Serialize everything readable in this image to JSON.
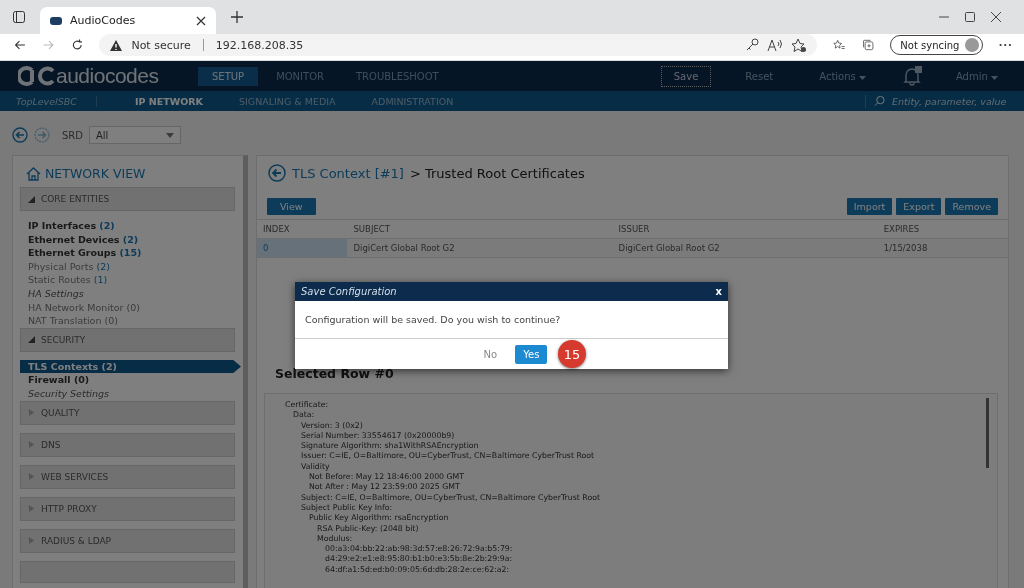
{
  "browser": {
    "tab_title": "AudioCodes",
    "security": "Not secure",
    "address": "192.168.208.35",
    "profile": "Not syncing"
  },
  "header": {
    "logo": "audiocodes",
    "tabs": [
      {
        "label": "SETUP",
        "selected": true
      },
      {
        "label": "MONITOR",
        "selected": false
      },
      {
        "label": "TROUBLESHOOT",
        "selected": false
      }
    ],
    "actions": [
      {
        "label": "Save",
        "kind": "outlined"
      },
      {
        "label": "Reset",
        "kind": "plain"
      },
      {
        "label": "Actions",
        "kind": "menu"
      }
    ],
    "user": "Admin"
  },
  "subnav": {
    "device": "TopLevelSBC",
    "tabs": [
      {
        "label": "IP NETWORK",
        "selected": true
      },
      {
        "label": "SIGNALING & MEDIA",
        "selected": false
      },
      {
        "label": "ADMINISTRATION",
        "selected": false
      }
    ],
    "search": {
      "placeholder": "Entity, parameter, value"
    }
  },
  "toolbar": {
    "srd_label": "SRD",
    "srd_value": "All"
  },
  "sidebar": {
    "title": "NETWORK VIEW",
    "sections": [
      {
        "label": "CORE ENTITIES",
        "expanded": true,
        "items": [
          {
            "label": "IP Interfaces",
            "count": "(2)",
            "kind": "entity",
            "selected": false
          },
          {
            "label": "Ethernet Devices",
            "count": "(2)",
            "kind": "entity",
            "selected": false
          },
          {
            "label": "Ethernet Groups",
            "count": "(15)",
            "kind": "entity",
            "selected": false
          },
          {
            "label": "Physical Ports",
            "count": "(2)",
            "kind": "plain",
            "selected": false
          },
          {
            "label": "Static Routes",
            "count": "(1)",
            "kind": "plain",
            "selected": false
          },
          {
            "label": "HA Settings",
            "kind": "page",
            "selected": false
          },
          {
            "label": "HA Network Monitor (0)",
            "kind": "plain",
            "selected": false
          },
          {
            "label": "NAT Translation (0)",
            "kind": "plain",
            "selected": false
          }
        ]
      },
      {
        "label": "SECURITY",
        "expanded": true,
        "items": [
          {
            "label": "TLS Contexts (2)",
            "kind": "entity",
            "selected": true
          },
          {
            "label": "Firewall (0)",
            "kind": "entity",
            "selected": false
          },
          {
            "label": "Security Settings",
            "kind": "page",
            "selected": false
          }
        ]
      },
      {
        "label": "QUALITY",
        "expanded": false
      },
      {
        "label": "DNS",
        "expanded": false
      },
      {
        "label": "WEB SERVICES",
        "expanded": false
      },
      {
        "label": "HTTP PROXY",
        "expanded": false
      },
      {
        "label": "RADIUS & LDAP",
        "expanded": false
      }
    ]
  },
  "main": {
    "breadcrumb_link": "TLS Context [#1]",
    "breadcrumb_rest": "> Trusted Root Certificates",
    "left_buttons": [
      "View"
    ],
    "right_buttons": [
      "Import",
      "Export",
      "Remove"
    ],
    "table": {
      "columns": [
        "INDEX",
        "SUBJECT",
        "ISSUER",
        "EXPIRES"
      ],
      "rows": [
        {
          "selected": true,
          "cells": [
            "0",
            "DigiCert Global Root G2",
            "DigiCert Global Root G2",
            "1/15/2038"
          ]
        }
      ]
    },
    "detail_title": "Selected Row #0",
    "certificate": [
      {
        "text": "Certificate:",
        "children": [
          {
            "text": "Data:",
            "children": [
              {
                "text": "Version: 3 (0x2)"
              },
              {
                "text": "Serial Number: 33554617 (0x20000b9)"
              },
              {
                "text": "Signature Algorithm: sha1WithRSAEncryption"
              },
              {
                "text": "Issuer: C=IE, O=Baltimore, OU=CyberTrust, CN=Baltimore CyberTrust Root"
              },
              {
                "text": "Validity",
                "children": [
                  {
                    "text": "Not Before: May 12 18:46:00 2000 GMT"
                  },
                  {
                    "text": "Not After : May 12 23:59:00 2025 GMT"
                  }
                ]
              },
              {
                "text": "Subject: C=IE, O=Baltimore, OU=CyberTrust, CN=Baltimore CyberTrust Root"
              },
              {
                "text": "Subject Public Key Info:",
                "children": [
                  {
                    "text": "Public Key Algorithm: rsaEncryption",
                    "children": [
                      {
                        "text": "RSA Public-Key: (2048 bit)"
                      },
                      {
                        "text": "Modulus:",
                        "children": [
                          {
                            "text": "00:a3:04:bb:22:ab:98:3d:57:e8:26:72:9a:b5:79:"
                          },
                          {
                            "text": "d4:29:e2:e1:e8:95:80:b1:b0:e3:5b:8e:2b:29:9a:"
                          },
                          {
                            "text": "64:df:a1:5d:ed:b0:09:05:6d:db:28:2e:ce:62:a2:"
                          }
                        ]
                      }
                    ]
                  }
                ]
              }
            ]
          }
        ]
      }
    ]
  },
  "dialog": {
    "title": "Save Configuration",
    "message": "Configuration will be saved. Do you wish to continue?",
    "close": "x",
    "buttons": [
      {
        "label": "No",
        "kind": "secondary"
      },
      {
        "label": "Yes",
        "kind": "primary"
      }
    ]
  },
  "step_marker": "15"
}
